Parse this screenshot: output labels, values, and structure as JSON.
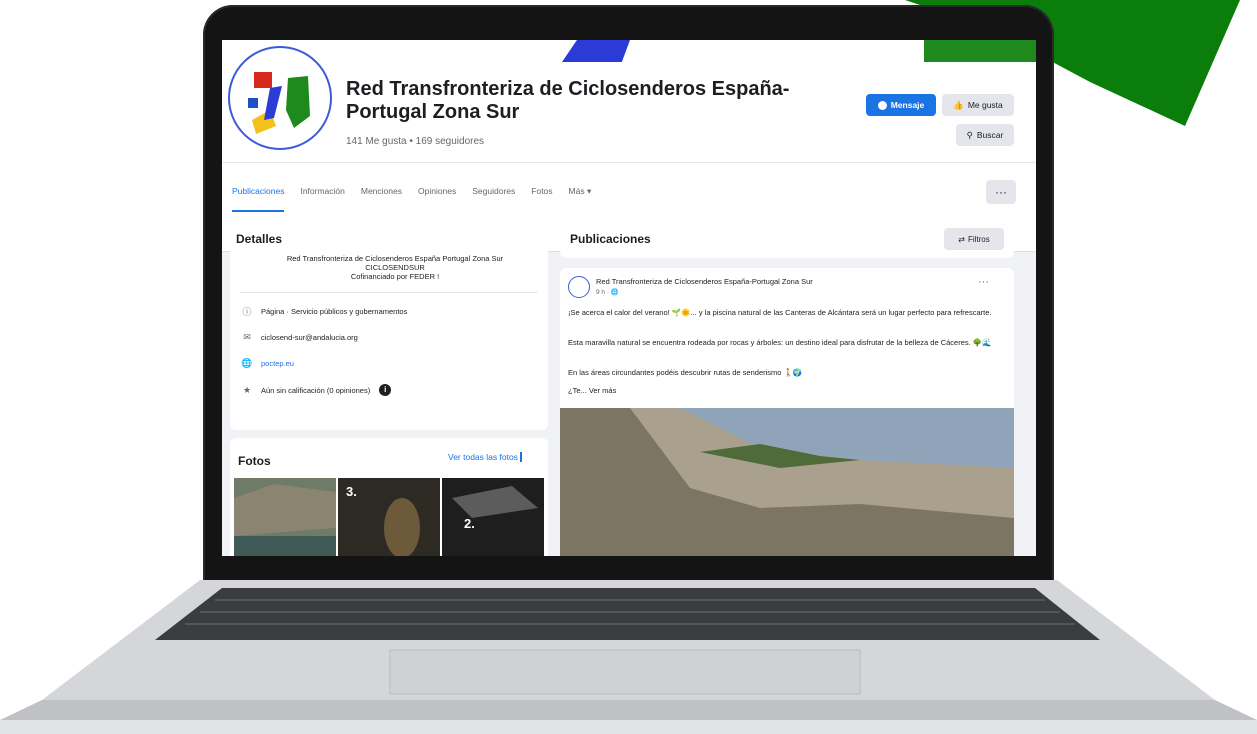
{
  "colors": {
    "accent_green": "#0a7d0a",
    "facebook_blue": "#1b74e4",
    "laptop_bezel": "#141414",
    "page_bg": "#f0f2f5"
  },
  "page": {
    "title": "Red Transfronteriza de Ciclosenderos España-Portugal Zona Sur",
    "stats": "141 Me gusta • 169 seguidores"
  },
  "actions": {
    "message_label": "Mensaje",
    "message_icon": "messenger-icon",
    "like_label": "Me gusta",
    "like_icon": "thumbs-up-icon",
    "search_label": "Buscar",
    "search_icon": "search-icon",
    "more_label": "···"
  },
  "tabs": [
    {
      "label": "Publicaciones",
      "active": true
    },
    {
      "label": "Información"
    },
    {
      "label": "Menciones"
    },
    {
      "label": "Opiniones"
    },
    {
      "label": "Seguidores"
    },
    {
      "label": "Fotos"
    },
    {
      "label": "Más ▾"
    }
  ],
  "details": {
    "title": "Detalles",
    "intro": [
      "Red Transfronteriza de Ciclosenderos España Portugal Zona Sur",
      "CICLOSENDSUR",
      "Cofinanciado por FEDER !"
    ],
    "rows": [
      {
        "icon": "info-icon",
        "text": "Página · Servicio públicos y gubernamentos"
      },
      {
        "icon": "email-icon",
        "text": "ciclosend-sur@andalucia.org"
      },
      {
        "icon": "web-icon",
        "text": "poctep.eu"
      },
      {
        "icon": "star-icon",
        "text": "Aún sin calificación (0 opiniones)"
      }
    ]
  },
  "photos": {
    "title": "Fotos",
    "see_all": "Ver todas las fotos",
    "thumb_labels": [
      "3.",
      "2."
    ]
  },
  "posts": {
    "title": "Publicaciones",
    "filter_label": "Filtros",
    "filter_icon": "sliders-icon",
    "author": "Red Transfronteriza de Ciclosenderos España-Portugal Zona Sur",
    "time": "9 h · 🌐",
    "paragraphs": [
      "¡Se acerca el calor del verano! 🌱🌞... y la piscina natural de las Canteras de Alcántara será un lugar perfecto para refrescarte.",
      "Esta maravilla natural se encuentra rodeada por rocas y árboles: un destino ideal para disfrutar de la belleza de Cáceres. 🌳🌊",
      "En las áreas circundantes podéis descubrir rutas de senderismo 🚶🌍",
      "¿Te... Ver más"
    ]
  }
}
